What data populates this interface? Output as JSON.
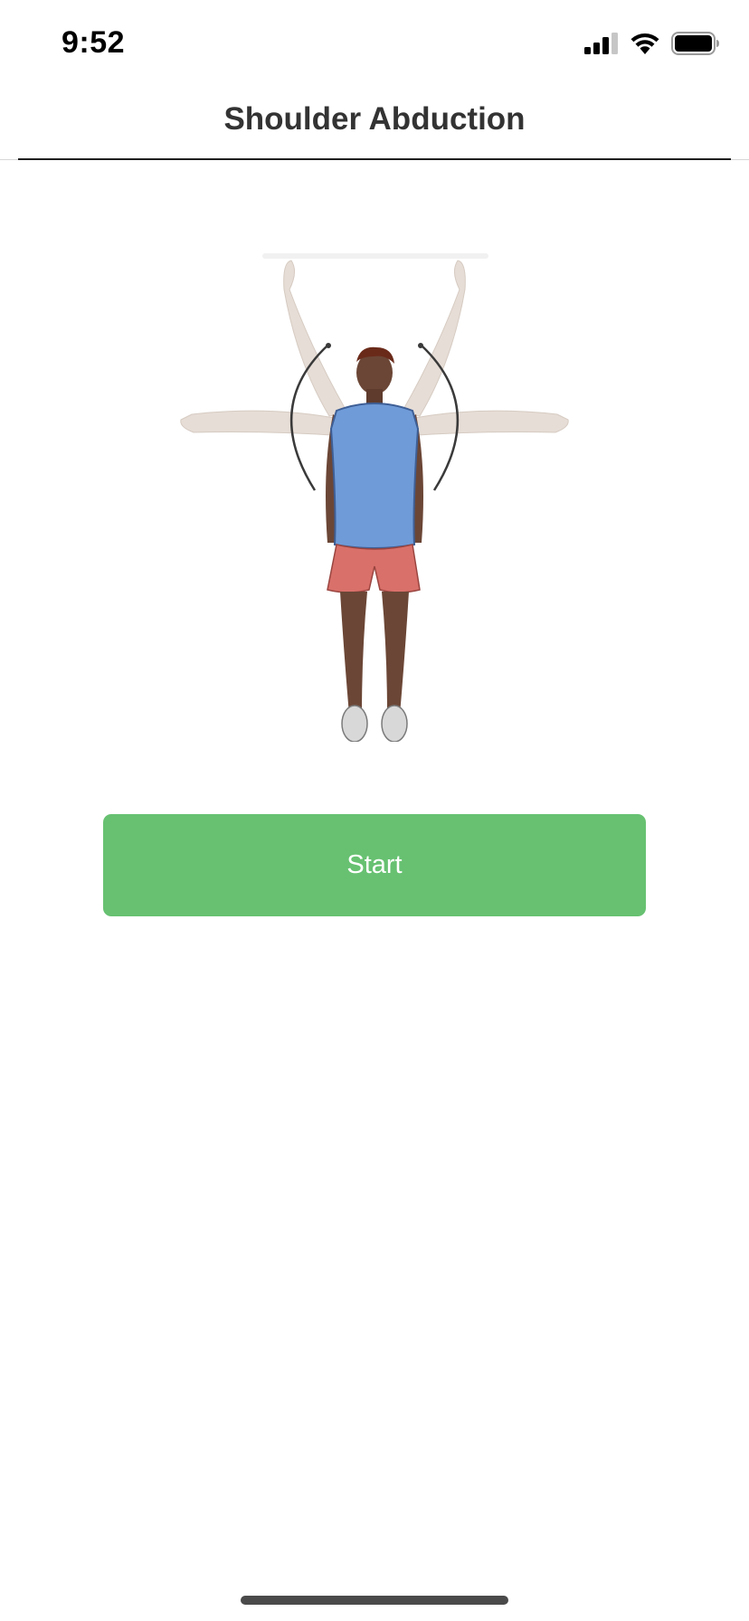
{
  "status_bar": {
    "time": "9:52",
    "icons": [
      "signal-icon",
      "wifi-icon",
      "battery-icon"
    ]
  },
  "header": {
    "title": "Shoulder Abduction"
  },
  "illustration": {
    "subject": "person-standing-shoulder-abduction-icon",
    "colors": {
      "shirt": "#6f9bd8",
      "shorts": "#d9706a",
      "skin": "#6b4636",
      "ghost_arms": "#e3dad4",
      "arc": "#333333"
    }
  },
  "actions": {
    "start_label": "Start",
    "start_color": "#67c171"
  }
}
